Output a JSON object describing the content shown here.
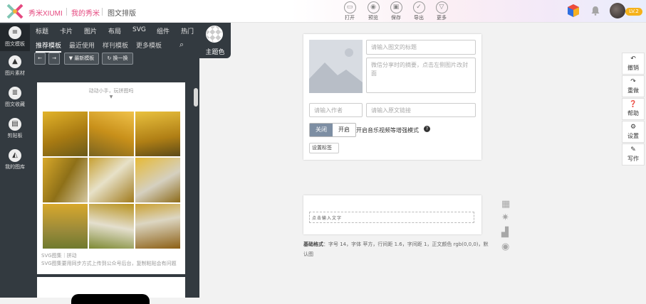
{
  "brand": {
    "name": "秀米XIUMI",
    "my": "我的秀米",
    "section": "图文排版"
  },
  "toolbar": {
    "items": [
      {
        "label": "打开",
        "icon": "folder-icon"
      },
      {
        "label": "预览",
        "icon": "eye-icon"
      },
      {
        "label": "保存",
        "icon": "save-icon"
      },
      {
        "label": "导出",
        "icon": "check-icon"
      },
      {
        "label": "更多",
        "icon": "chevron-down-icon"
      }
    ]
  },
  "user": {
    "level": "LV.2"
  },
  "rail": {
    "items": [
      {
        "label": "图文模板",
        "icon": "list-icon"
      },
      {
        "label": "图片素材",
        "icon": "image-icon"
      },
      {
        "label": "图文收藏",
        "icon": "doc-icon"
      },
      {
        "label": "剪贴板",
        "icon": "clipboard-icon"
      },
      {
        "label": "我的图库",
        "icon": "gallery-icon"
      }
    ]
  },
  "library": {
    "categories": [
      "标题",
      "卡片",
      "图片",
      "布局",
      "SVG",
      "组件",
      "热门"
    ],
    "subtabs": [
      "推荐模板",
      "最近使用",
      "样刊模板",
      "更多模板"
    ],
    "new_label": "最新模板",
    "swap_label": "换一换",
    "theme_label": "主题色",
    "preview_hint": "动动小手，玩拼图吗",
    "item_meta": "SVG图集｜拼动",
    "item_note": "SVG图集要用同步方式上传到公众号后台，复制粘贴会有问题"
  },
  "editor": {
    "title_placeholder": "请输入图文的标题",
    "summary_placeholder": "微信分享时的摘要，点击左侧图片改封面",
    "author_placeholder": "请输入作者",
    "link_placeholder": "请输入原文链接",
    "toggle_off": "关闭",
    "toggle_on": "开启",
    "music_mode": "开启音乐视频等增强模式",
    "tag_button": "设置标签",
    "text_placeholder": "点击输入文字",
    "format_title": "基础格式",
    "format_text": "：字号 14，字体 苹方，行间距 1.6，字间距 1，正文颜色 rgb(0,0,0)，默认图"
  },
  "actions": [
    {
      "label": "撤销",
      "icon": "undo-icon"
    },
    {
      "label": "重做",
      "icon": "redo-icon"
    },
    {
      "label": "帮助",
      "icon": "help-icon"
    },
    {
      "label": "设置",
      "icon": "settings-icon"
    },
    {
      "label": "写作",
      "icon": "pen-icon"
    }
  ],
  "colors": {
    "brand": "#e5487f",
    "sidebar": "#333a40",
    "toggle_active": "#7d8ea3"
  }
}
